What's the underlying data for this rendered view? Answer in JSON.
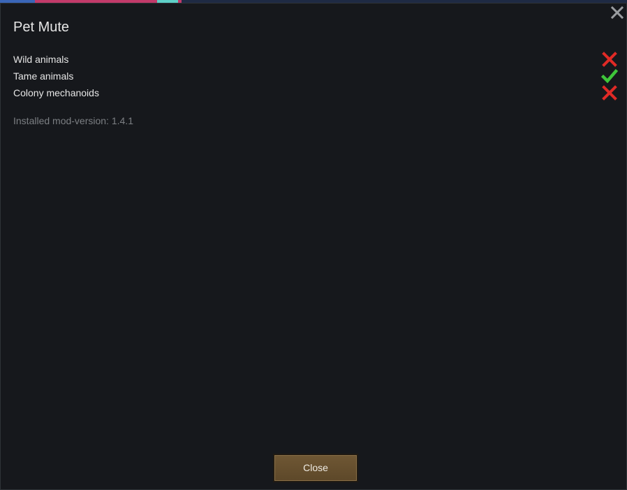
{
  "dialog": {
    "title": "Pet Mute",
    "close_icon": "close-icon"
  },
  "settings": [
    {
      "label": "Wild animals",
      "enabled": false,
      "icon": "cross-icon",
      "color": "#e02a26"
    },
    {
      "label": "Tame animals",
      "enabled": true,
      "icon": "checkmark-icon",
      "color": "#3ec53a"
    },
    {
      "label": "Colony mechanoids",
      "enabled": false,
      "icon": "cross-icon",
      "color": "#e02a26"
    }
  ],
  "footer": {
    "version_text": "Installed mod-version: 1.4.1",
    "close_label": "Close"
  },
  "colors": {
    "background": "#15171b",
    "button": "#6a5331",
    "text": "#e6e6e6",
    "muted_text": "#7c7f83"
  }
}
